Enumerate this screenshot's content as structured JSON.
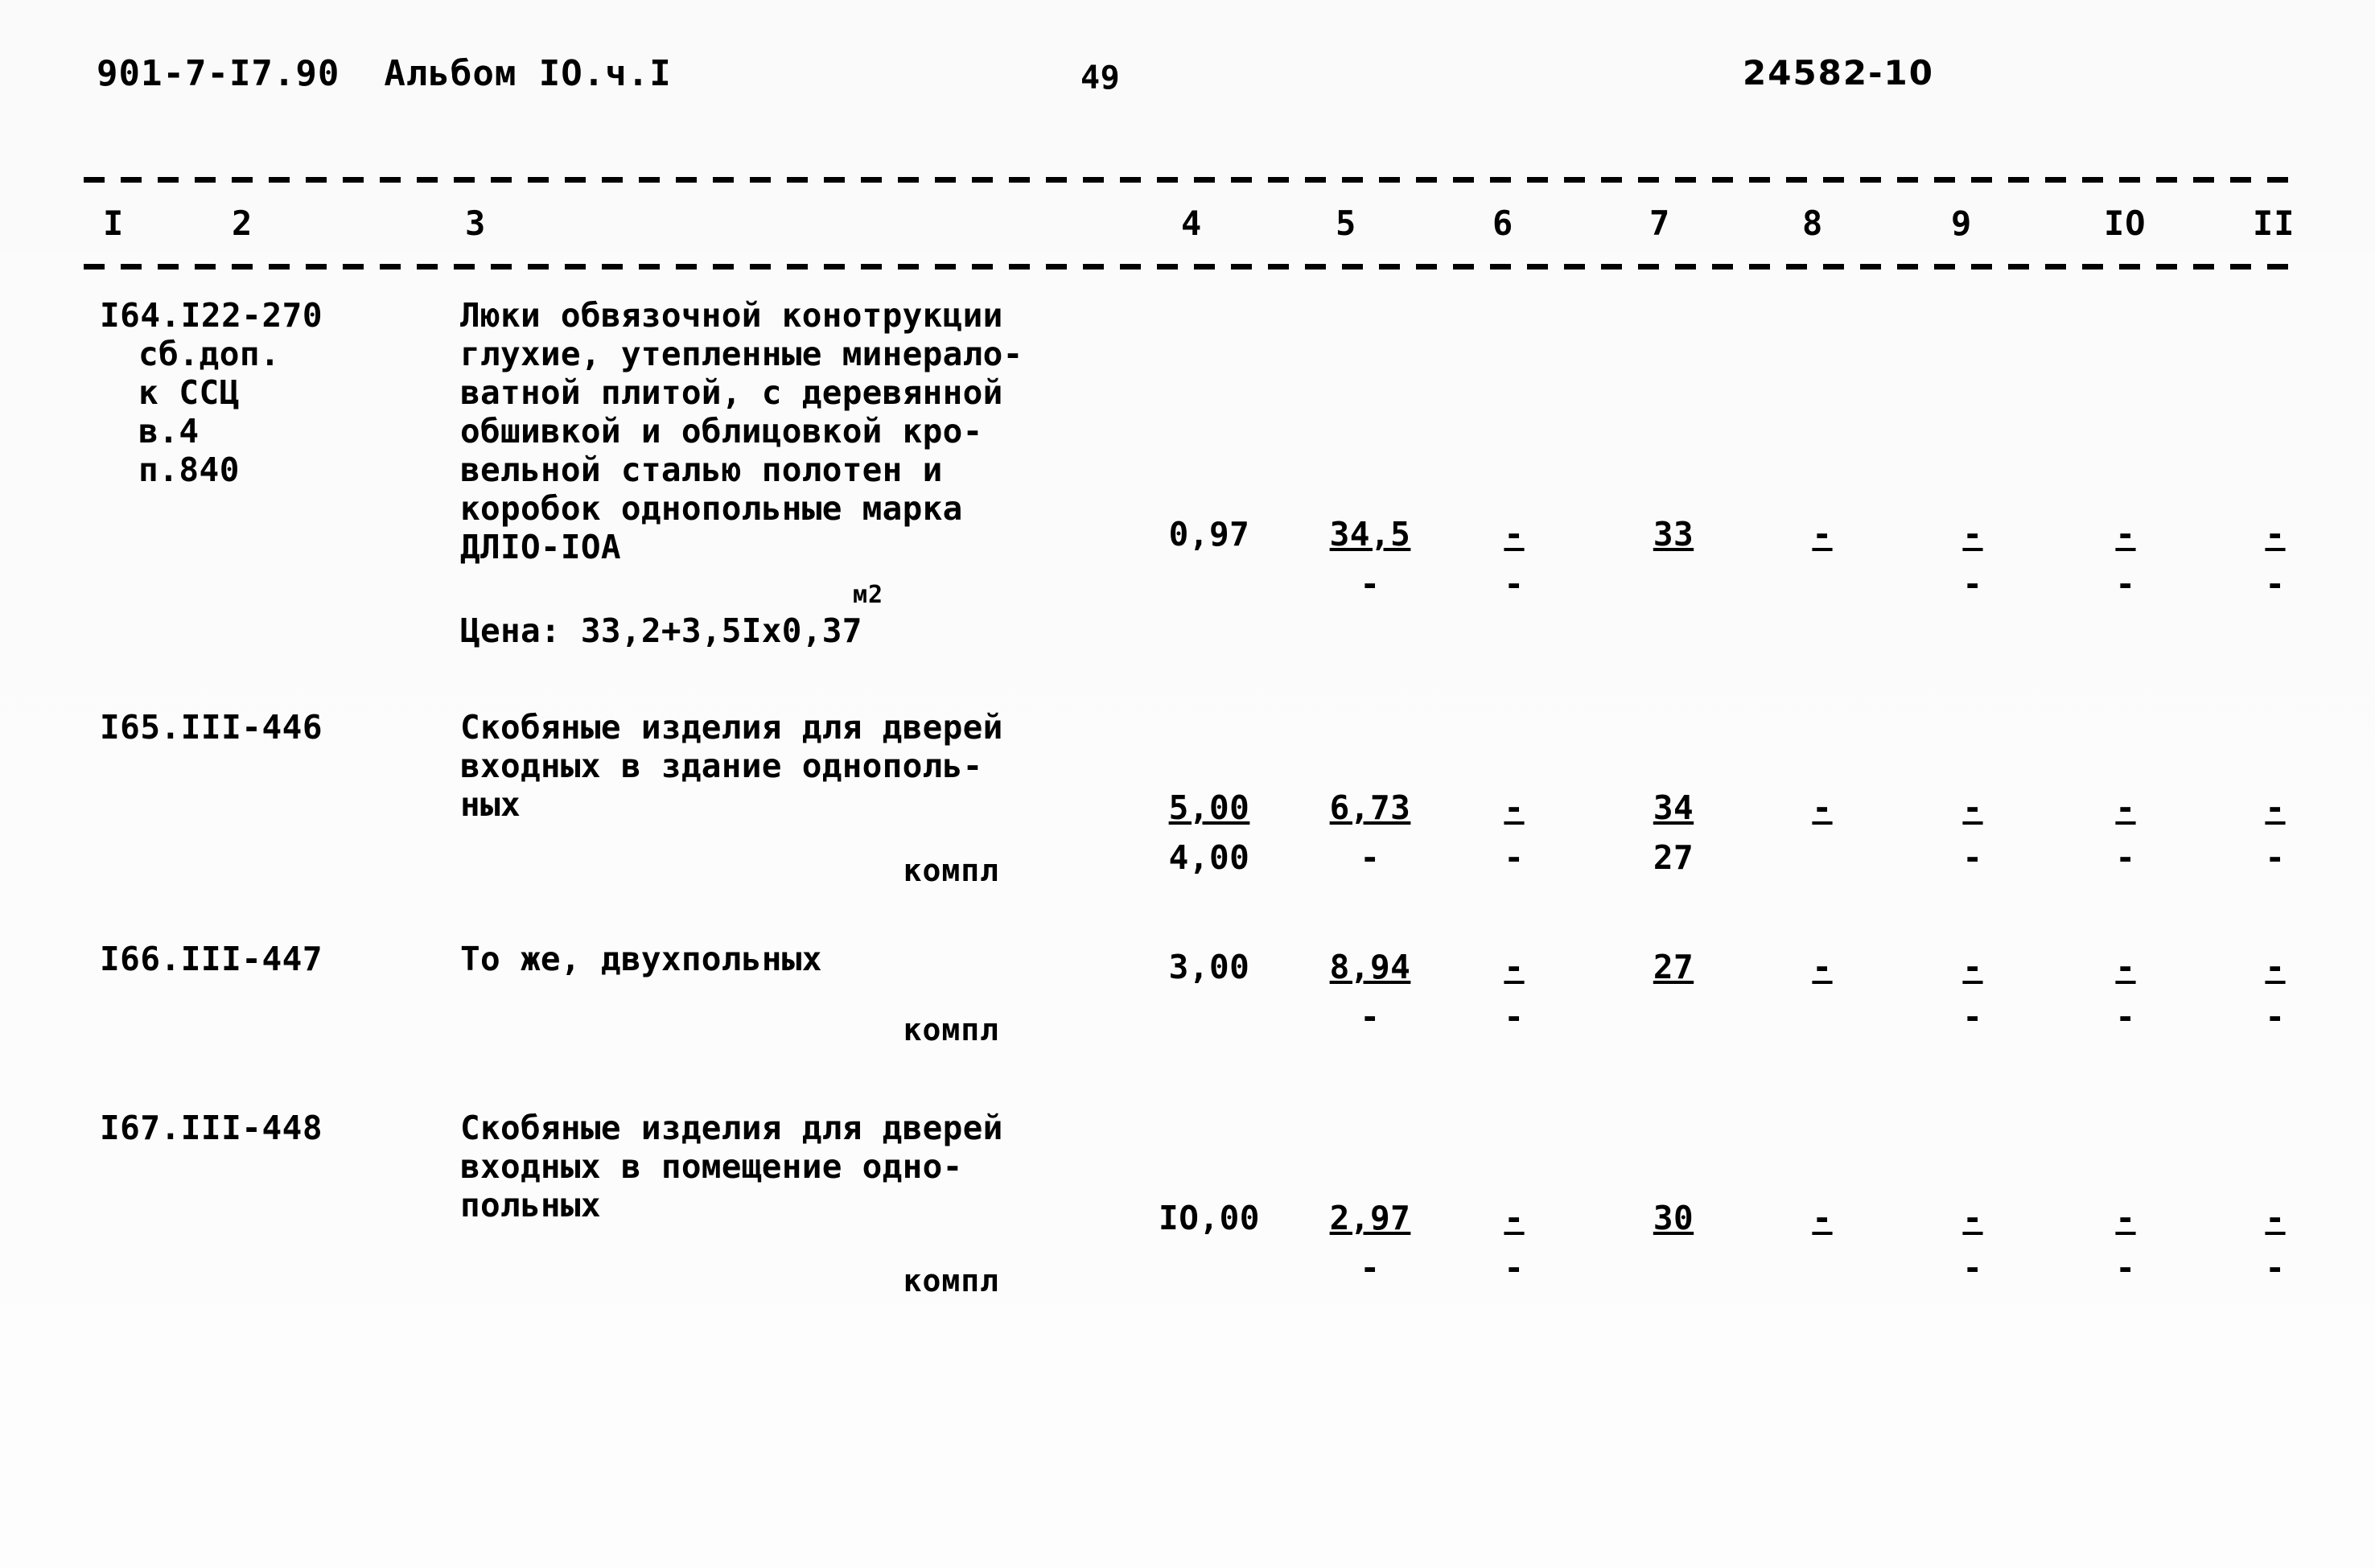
{
  "header": {
    "document_code": "901-7-I7.90  Альбом IO.ч.I",
    "page_number": "49",
    "stamp_number": "24582-10"
  },
  "table": {
    "column_headers": [
      "I",
      "2",
      "3",
      "4",
      "5",
      "6",
      "7",
      "8",
      "9",
      "IO",
      "II"
    ],
    "rows": [
      {
        "code_lines": [
          "I64.I22-270",
          "сб.доп.",
          "к ССЦ",
          "в.4",
          "п.840"
        ],
        "description_lines": [
          "Люки обвязочной конотрукции",
          "глухие, утепленные минерало-",
          "ватной плитой, с деревянной",
          "обшивкой и облицовкой кро-",
          "вельной сталью полотен и",
          "коробок однопольные марка",
          "ДЛIО-IОА"
        ],
        "unit": "",
        "price_note": "Цена: 33,2+3,5Iх0,37",
        "price_superscript": "м2",
        "values_top": [
          "0,97",
          "34,5",
          "-",
          "33",
          "-",
          "-",
          "-",
          "-"
        ],
        "values_bottom": [
          "",
          "-",
          "-",
          "",
          "",
          "-",
          "-",
          "-"
        ]
      },
      {
        "code_lines": [
          "I65.III-446"
        ],
        "description_lines": [
          "Скобяные изделия для дверей",
          "входных в здание однополь-",
          "ных"
        ],
        "unit": "компл",
        "price_note": "",
        "price_superscript": "",
        "values_top": [
          "5,00",
          "6,73",
          "-",
          "34",
          "-",
          "-",
          "-",
          "-"
        ],
        "values_bottom": [
          "4,00",
          "-",
          "-",
          "27",
          "",
          "-",
          "-",
          "-"
        ]
      },
      {
        "code_lines": [
          "I66.III-447"
        ],
        "description_lines": [
          "То же, двухпольных"
        ],
        "unit": "компл",
        "price_note": "",
        "price_superscript": "",
        "values_top": [
          "3,00",
          "8,94",
          "-",
          "27",
          "-",
          "-",
          "-",
          "-"
        ],
        "values_bottom": [
          "",
          "-",
          "-",
          "",
          "",
          "-",
          "-",
          "-"
        ]
      },
      {
        "code_lines": [
          "I67.III-448"
        ],
        "description_lines": [
          "Скобяные изделия для дверей",
          "входных в помещение одно-",
          "польных"
        ],
        "unit": "компл",
        "price_note": "",
        "price_superscript": "",
        "values_top": [
          "IO,00",
          "2,97",
          "-",
          "30",
          "-",
          "-",
          "-",
          "-"
        ],
        "values_bottom": [
          "",
          "-",
          "-",
          "",
          "",
          "-",
          "-",
          "-"
        ]
      }
    ]
  },
  "layout": {
    "col_head_x": [
      128,
      288,
      578,
      1468,
      1660,
      1855,
      2050,
      2240,
      2425,
      2615,
      2800
    ],
    "value_col_x": [
      1428,
      1628,
      1822,
      2020,
      2205,
      2392,
      2582,
      2768
    ],
    "value_col_w": [
      150,
      150,
      120,
      120,
      120,
      120,
      120,
      120
    ]
  }
}
